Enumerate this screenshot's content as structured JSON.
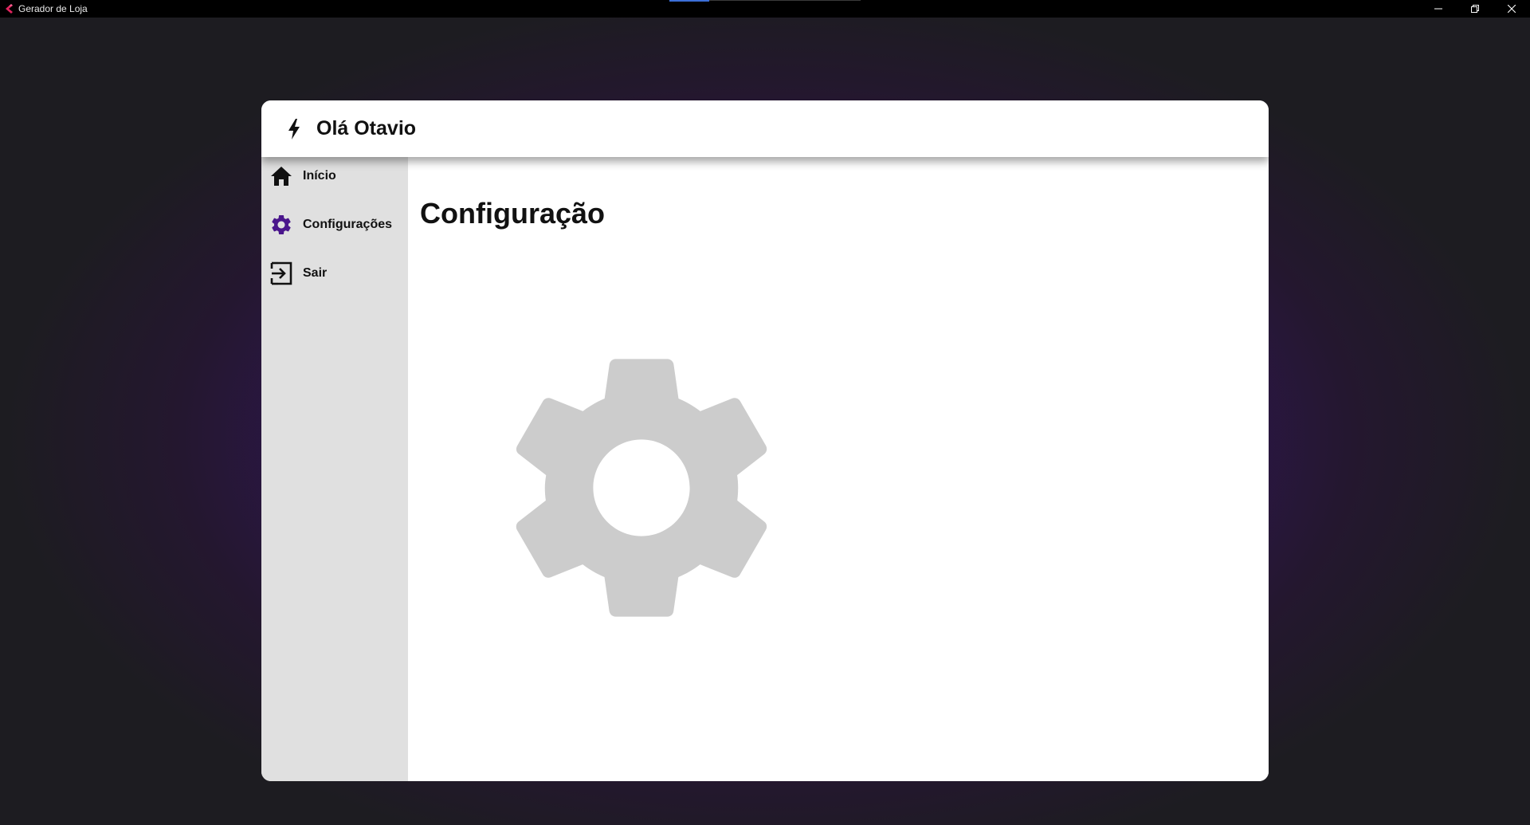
{
  "window": {
    "title": "Gerador de Loja",
    "controls": [
      "minimize",
      "restore",
      "close"
    ]
  },
  "header": {
    "icon": "bolt-icon",
    "greeting": "Olá Otavio"
  },
  "sidebar": {
    "items": [
      {
        "label": "Início",
        "icon": "home-icon",
        "active": false
      },
      {
        "label": "Configurações",
        "icon": "gear-icon",
        "active": true
      },
      {
        "label": "Sair",
        "icon": "exit-icon",
        "active": false
      }
    ]
  },
  "main": {
    "title": "Configuração",
    "illustration": "settings-gear-icon"
  },
  "colors": {
    "accent": "#4a168c",
    "sidebar_bg": "#e0e0e0",
    "gear_placeholder": "#cccccc",
    "glow": "#3a1a64",
    "background": "#1c1c20"
  }
}
